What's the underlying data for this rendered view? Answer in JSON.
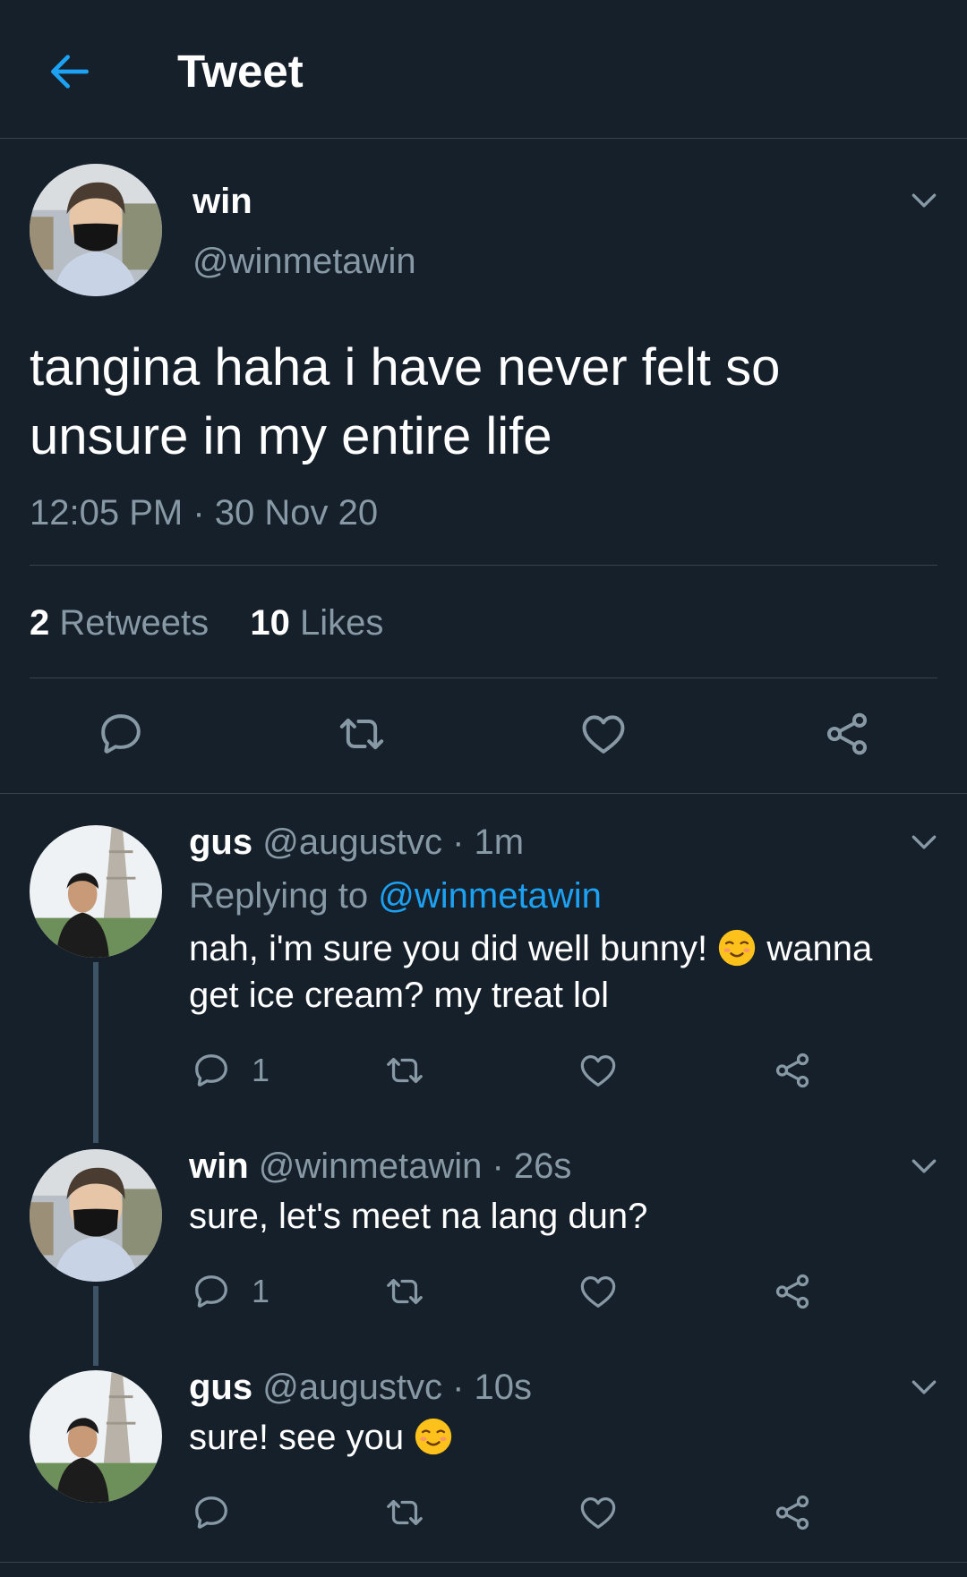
{
  "header": {
    "title": "Tweet"
  },
  "main_tweet": {
    "name": "win",
    "handle": "@winmetawin",
    "text": "tangina haha i have never felt so unsure in my entire life",
    "timestamp": "12:05 PM · 30 Nov 20",
    "retweets_count": "2",
    "retweets_label": "Retweets",
    "likes_count": "10",
    "likes_label": "Likes"
  },
  "replies": [
    {
      "name": "gus",
      "handle": "@augustvc",
      "time": "· 1m",
      "replying_label": "Replying to",
      "replying_to": "@winmetawin",
      "text_part1": "nah, i'm sure you did well bunny!",
      "text_part2": "wanna get ice cream? my treat lol",
      "reply_count": "1"
    },
    {
      "name": "win",
      "handle": "@winmetawin",
      "time": "· 26s",
      "text": "sure, let's meet na lang dun?",
      "reply_count": "1"
    },
    {
      "name": "gus",
      "handle": "@augustvc",
      "time": "· 10s",
      "text": "sure! see you"
    }
  ],
  "colors": {
    "background": "#15202b",
    "accent": "#1da1f2",
    "muted": "#8899a6",
    "divider": "#38444d"
  },
  "icons": [
    "back-arrow-icon",
    "chevron-down-icon",
    "reply-icon",
    "retweet-icon",
    "like-icon",
    "share-icon",
    "smiling-face-emoji"
  ]
}
